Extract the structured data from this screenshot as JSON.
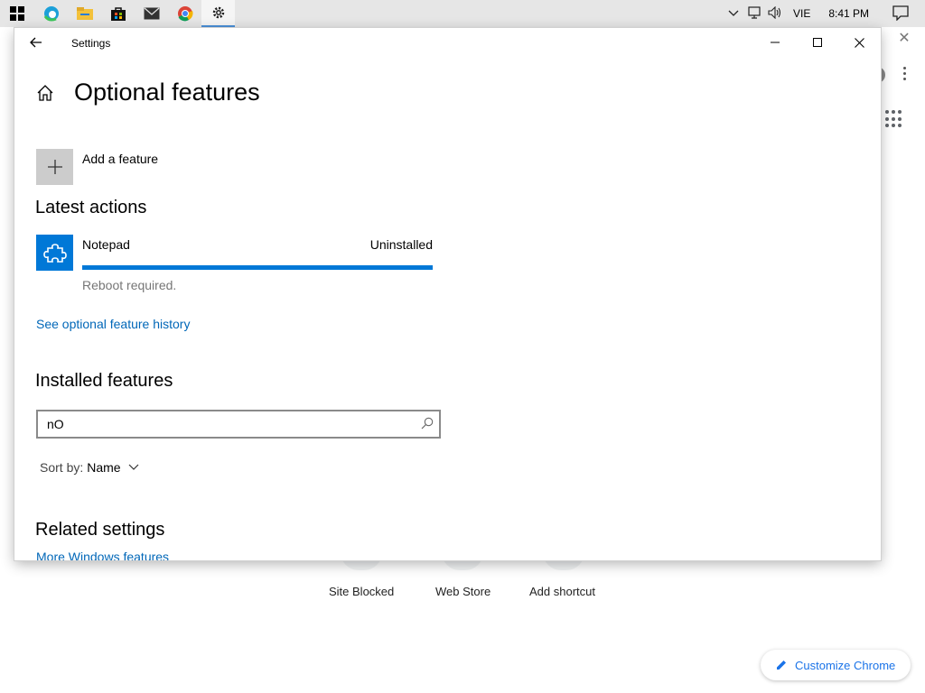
{
  "taskbar": {
    "icons": [
      "windows-start-icon",
      "edge-icon",
      "file-explorer-icon",
      "microsoft-store-icon",
      "mail-icon",
      "chrome-icon",
      "settings-icon"
    ],
    "language": "VIE",
    "time": "8:41 PM"
  },
  "chrome": {
    "shortcuts": [
      "Site Blocked",
      "Web Store",
      "Add shortcut"
    ],
    "customize_label": "Customize Chrome"
  },
  "window": {
    "title": "Settings"
  },
  "page": {
    "title": "Optional features",
    "add_feature_label": "Add a feature",
    "latest_actions_heading": "Latest actions",
    "latest_feature": {
      "name": "Notepad",
      "status": "Uninstalled",
      "progress": 1.0,
      "note": "Reboot required."
    },
    "history_link": "See optional feature history",
    "installed_heading": "Installed features",
    "search": {
      "value": "nO"
    },
    "sort": {
      "label": "Sort by:",
      "value": "Name"
    },
    "related_heading": "Related settings",
    "related_link": "More Windows features"
  },
  "colors": {
    "accent": "#0078d7",
    "link": "#0067b8",
    "chrome_blue": "#1a73e8"
  }
}
